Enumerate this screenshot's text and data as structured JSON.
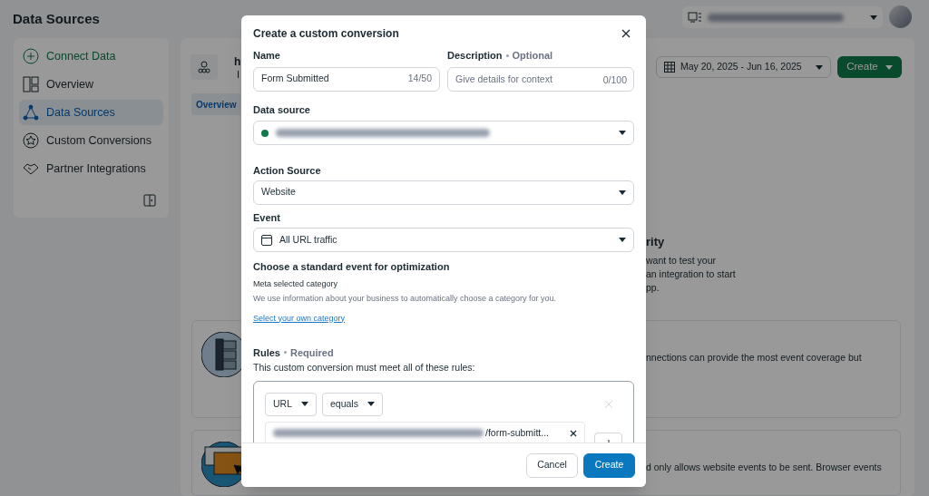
{
  "page_title": "Data Sources",
  "sidebar": {
    "items": [
      {
        "label": "Connect Data",
        "kind": "action",
        "selected": false
      },
      {
        "label": "Overview",
        "kind": "nav",
        "selected": false
      },
      {
        "label": "Data Sources",
        "kind": "nav",
        "selected": true
      },
      {
        "label": "Custom Conversions",
        "kind": "nav",
        "selected": false
      },
      {
        "label": "Partner Integrations",
        "kind": "nav",
        "selected": false
      }
    ]
  },
  "main": {
    "source_name": "h",
    "source_id": "I",
    "tabs": [
      {
        "label": "Overview",
        "selected": true
      }
    ],
    "date_range": "May 20, 2025 - Jun 16, 2025",
    "create_button": "Create",
    "heading": "rity",
    "body_lines": [
      "want to test your",
      "an integration to start",
      "pp."
    ],
    "cards": [
      {
        "text": "nnections can provide the most event coverage but"
      },
      {
        "text": "d only allows website events to be sent. Browser events"
      }
    ]
  },
  "dialog": {
    "title": "Create a custom conversion",
    "name": {
      "label": "Name",
      "value": "Form Submitted",
      "counter": "14/50"
    },
    "description": {
      "label": "Description",
      "qualifier": "Optional",
      "placeholder": "Give details for context",
      "counter": "0/100"
    },
    "data_source": {
      "label": "Data source",
      "color": "#0f7a4a"
    },
    "action_source": {
      "label": "Action Source",
      "value": "Website"
    },
    "event": {
      "label": "Event",
      "value": "All URL traffic"
    },
    "optimization": {
      "heading": "Choose a standard event for optimization",
      "subheading": "Meta selected category",
      "description": "We use information about your business to automatically choose a category for you.",
      "link": "Select your own category"
    },
    "rules": {
      "label": "Rules",
      "qualifier": "Required",
      "description": "This custom conversion must meet all of these rules:",
      "items": [
        {
          "field": "URL",
          "operator": "equals",
          "value_suffix": "/form-submitt..."
        }
      ]
    },
    "buttons": [
      {
        "label": "Cancel",
        "kind": "secondary"
      },
      {
        "label": "Create",
        "kind": "primary"
      }
    ]
  }
}
